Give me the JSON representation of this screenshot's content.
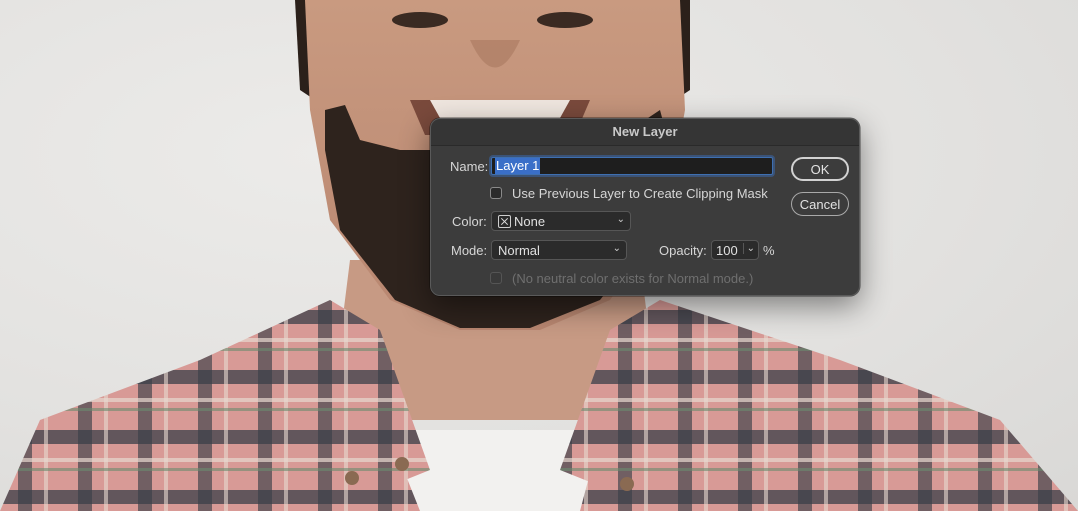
{
  "dialog": {
    "title": "New Layer",
    "name_label": "Name:",
    "name_value": "Layer 1",
    "clipping_mask_label": "Use Previous Layer to Create Clipping Mask",
    "clipping_mask_checked": false,
    "color_label": "Color:",
    "color_value": "None",
    "mode_label": "Mode:",
    "mode_value": "Normal",
    "opacity_label": "Opacity:",
    "opacity_value": "100",
    "opacity_unit": "%",
    "neutral_color_label": "(No neutral color exists for Normal mode.)",
    "ok_label": "OK",
    "cancel_label": "Cancel"
  },
  "colors": {
    "dialog_bg": "#3c3c3c",
    "selection": "#3a6fc8",
    "input_focus": "#3e6fb0"
  }
}
